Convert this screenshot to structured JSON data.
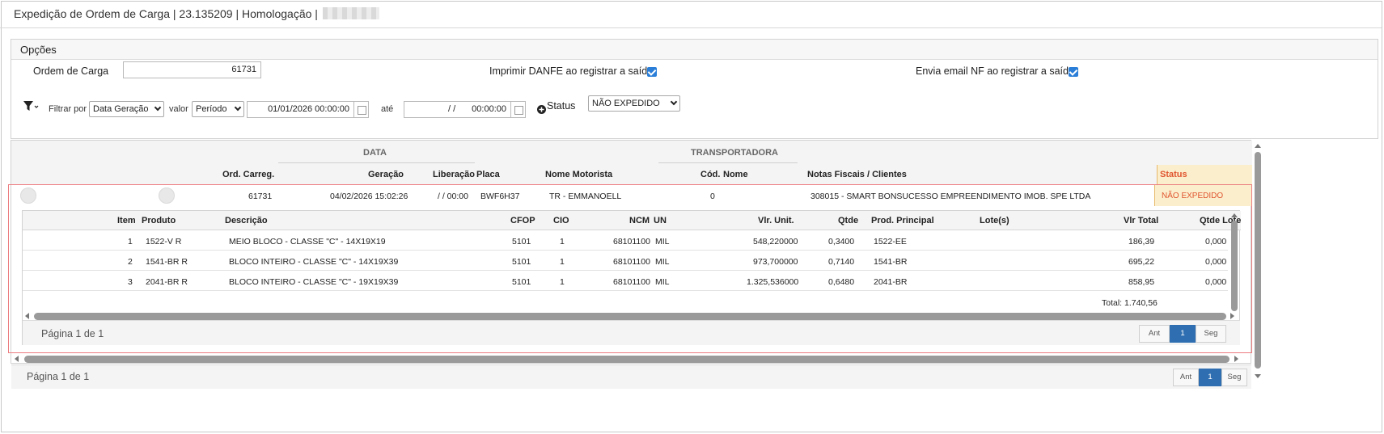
{
  "header": {
    "title": "Expedição de Ordem de Carga | 23.135209 | Homologação |"
  },
  "options": {
    "title": "Opções",
    "ordem_label": "Ordem de Carga",
    "ordem_value": "61731",
    "danfe_label": "Imprimir DANFE ao registrar a saída",
    "email_label": "Envia email NF ao registrar a saída",
    "filtrar_label": "Filtrar por",
    "filtrar_value": "Data Geração",
    "valor_label": "valor",
    "valor_value": "Período",
    "date_from": "01/01/2026 00:00:00",
    "ate_label": "até",
    "date_to_date": "/ /",
    "date_to_time": "00:00:00",
    "status_label": "Status",
    "status_value": "NÃO EXPEDIDO"
  },
  "grid": {
    "group_data": "DATA",
    "group_transportadora": "TRANSPORTADORA",
    "columns": {
      "ord": "Ord. Carreg.",
      "geracao": "Geração",
      "liberacao": "Liberação",
      "placa": "Placa",
      "motorista": "Nome Motorista",
      "cod": "Cód.",
      "nome": "Nome",
      "notas": "Notas Fiscais / Clientes",
      "status": "Status"
    },
    "row": {
      "ord": "61731",
      "geracao": "04/02/2026 15:02:26",
      "liberacao": "/ / 00:00",
      "placa": "BWF6H37",
      "motorista": "TR - EMMANOELL",
      "cod": "0",
      "nome": "",
      "notas": "308015 - SMART BONSUCESSO EMPREENDIMENTO IMOB. SPE LTDA",
      "status": "NÃO EXPEDIDO"
    },
    "pager_text": "Página 1 de 1",
    "pager_prev": "Ant",
    "pager_page": "1",
    "pager_next": "Seg"
  },
  "detail": {
    "columns": {
      "item": "Item",
      "produto": "Produto",
      "descricao": "Descrição",
      "cfop": "CFOP",
      "cio": "CIO",
      "ncm": "NCM",
      "un": "UN",
      "vlr_unit": "Vlr. Unit.",
      "qtde": "Qtde",
      "prod_principal": "Prod. Principal",
      "lotes": "Lote(s)",
      "vlr_total": "Vlr Total",
      "qtde_lote": "Qtde Lote"
    },
    "rows": [
      {
        "item": "1",
        "produto": "1522-V R",
        "descricao": "MEIO BLOCO - CLASSE \"C\" - 14X19X19",
        "cfop": "5101",
        "cio": "1",
        "ncm": "68101100",
        "un": "MIL",
        "vlr_unit": "548,220000",
        "qtde": "0,3400",
        "prod_principal": "1522-EE",
        "lotes": "",
        "vlr_total": "186,39",
        "qtde_lote": "0,000"
      },
      {
        "item": "2",
        "produto": "1541-BR R",
        "descricao": "BLOCO INTEIRO - CLASSE \"C\" - 14X19X39",
        "cfop": "5101",
        "cio": "1",
        "ncm": "68101100",
        "un": "MIL",
        "vlr_unit": "973,700000",
        "qtde": "0,7140",
        "prod_principal": "1541-BR",
        "lotes": "",
        "vlr_total": "695,22",
        "qtde_lote": "0,000"
      },
      {
        "item": "3",
        "produto": "2041-BR R",
        "descricao": "BLOCO INTEIRO - CLASSE \"C\" - 19X19X39",
        "cfop": "5101",
        "cio": "1",
        "ncm": "68101100",
        "un": "MIL",
        "vlr_unit": "1.325,536000",
        "qtde": "0,6480",
        "prod_principal": "2041-BR",
        "lotes": "",
        "vlr_total": "858,95",
        "qtde_lote": "0,000"
      }
    ],
    "total": "Total: 1.740,56",
    "pager_text": "Página 1 de 1",
    "pager_prev": "Ant",
    "pager_page": "1",
    "pager_next": "Seg"
  }
}
